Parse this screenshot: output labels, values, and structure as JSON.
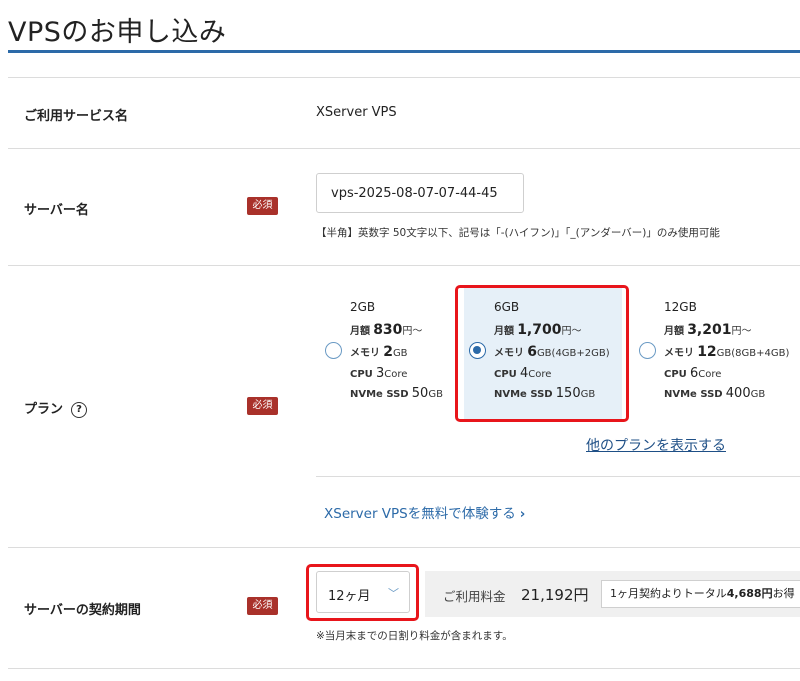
{
  "page": {
    "title": "VPSのお申し込み"
  },
  "required_badge": "必須",
  "service": {
    "label": "ご利用サービス名",
    "value": "XServer VPS"
  },
  "server_name": {
    "label": "サーバー名",
    "value": "vps-2025-08-07-07-44-45",
    "hint": "【半角】英数字 50文字以下、記号は「-(ハイフン)」「_(アンダーバー)」のみ使用可能"
  },
  "plan": {
    "label": "プラン",
    "help_icon": "question-circle-icon",
    "price_prefix": "月額",
    "memory_prefix": "メモリ",
    "cpu_prefix": "CPU",
    "ssd_prefix": "NVMe SSD",
    "options": [
      {
        "name": "2GB",
        "price": "830",
        "price_unit": "円～",
        "memory": "2",
        "memory_unit": "GB",
        "cpu": "3",
        "cpu_unit": "Core",
        "ssd": "50",
        "ssd_unit": "GB",
        "selected": false
      },
      {
        "name": "6GB",
        "price": "1,700",
        "price_unit": "円～",
        "memory": "6",
        "memory_unit": "GB(4GB+2GB)",
        "cpu": "4",
        "cpu_unit": "Core",
        "ssd": "150",
        "ssd_unit": "GB",
        "selected": true
      },
      {
        "name": "12GB",
        "price": "3,201",
        "price_unit": "円～",
        "memory": "12",
        "memory_unit": "GB(8GB+4GB)",
        "cpu": "6",
        "cpu_unit": "Core",
        "ssd": "400",
        "ssd_unit": "GB",
        "selected": false
      }
    ],
    "more_link": "他のプランを表示する",
    "trial_link": "XServer VPSを無料で体験する",
    "trial_icon": "chevron-right-icon"
  },
  "contract": {
    "label": "サーバーの契約期間",
    "selected": "12ヶ月",
    "select_icon": "chevron-down-icon",
    "fee_label": "ご利用料金",
    "fee_value": "21,192円",
    "fee_note_prefix": "1ヶ月契約よりトータル",
    "fee_note_amount": "4,688円",
    "fee_note_suffix": "お得",
    "footnote": "※当月末までの日割り料金が含まれます。"
  },
  "colors": {
    "accent": "#2c6aa8",
    "required": "#a9312a",
    "highlight": "#e8151b",
    "selected_bg": "#e6f0f8"
  }
}
